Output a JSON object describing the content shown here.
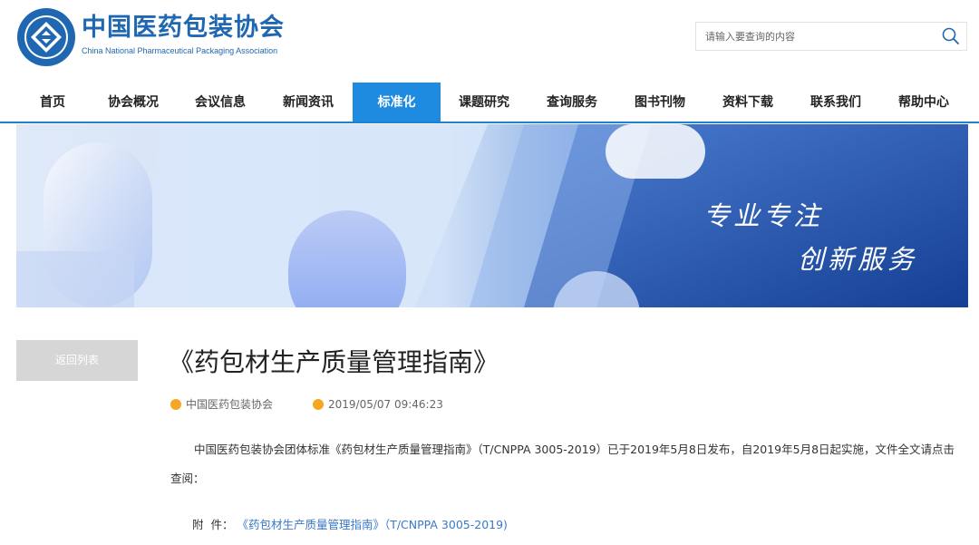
{
  "header": {
    "brand_cn": "中国医药包装协会",
    "brand_en": "China National Pharmaceutical Packaging Association",
    "logo_icon": "association-logo-icon",
    "search_placeholder": "请输入要查询的内容",
    "search_icon": "search-icon"
  },
  "nav": {
    "items": [
      {
        "label": "首页"
      },
      {
        "label": "协会概况"
      },
      {
        "label": "会议信息"
      },
      {
        "label": "新闻资讯"
      },
      {
        "label": "标准化",
        "active": true
      },
      {
        "label": "课题研究"
      },
      {
        "label": "查询服务"
      },
      {
        "label": "图书刊物"
      },
      {
        "label": "资料下载"
      },
      {
        "label": "联系我们"
      },
      {
        "label": "帮助中心"
      }
    ],
    "accent_color": "#1e8ae0"
  },
  "banner": {
    "line1": "专业专注",
    "line2": "创新服务"
  },
  "sidebar": {
    "back_label": "返回列表"
  },
  "article": {
    "title": "《药包材生产质量管理指南》",
    "source": "中国医药包装协会",
    "date": "2019/05/07 09:46:23",
    "body": "中国医药包装协会团体标准《药包材生产质量管理指南》（T/CNPPA 3005-2019）已于2019年5月8日发布，自2019年5月8日起实施，文件全文请点击查阅：",
    "attachment_label": "附  件：",
    "attachment_link": "《药包材生产质量管理指南》（T/CNPPA 3005-2019)"
  }
}
